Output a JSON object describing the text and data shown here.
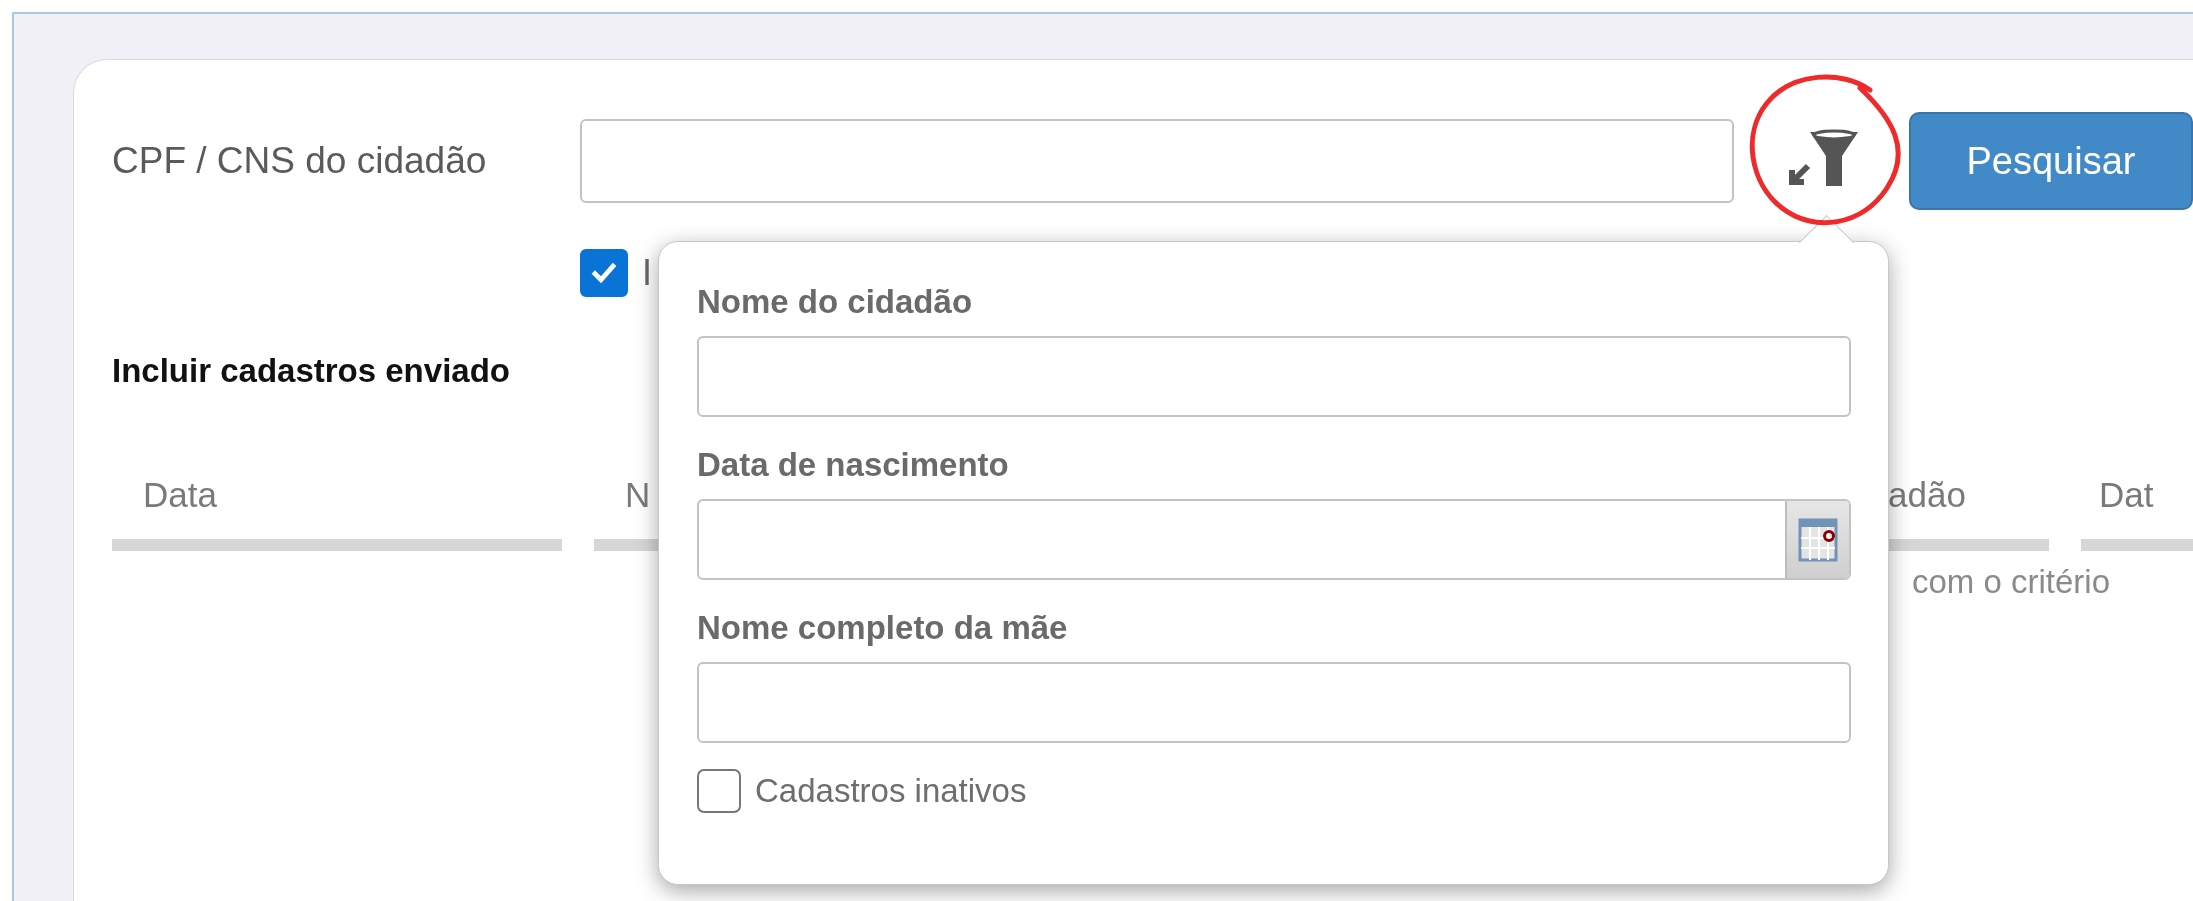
{
  "search": {
    "label": "CPF / CNS do cidadão"
  },
  "search_button": "Pesquisar",
  "sent_option": {
    "label": "I",
    "checked": true
  },
  "include_sent_label": "Incluir cadastros enviado",
  "table": {
    "columns": [
      "Data",
      "N",
      "adão",
      "Dat"
    ],
    "empty_message": "com o critério"
  },
  "filter_popup": {
    "fields": [
      {
        "label": "Nome do cidadão",
        "kind": "text"
      },
      {
        "label": "Data de nascimento",
        "kind": "date"
      },
      {
        "label": "Nome completo da mãe",
        "kind": "text"
      }
    ],
    "inactive_option": {
      "label": "Cadastros inativos",
      "checked": false
    }
  }
}
